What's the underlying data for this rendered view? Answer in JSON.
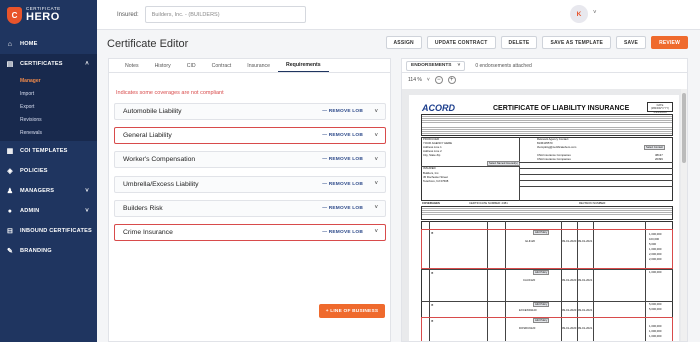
{
  "app": {
    "logo_small": "CERTIFICATE",
    "logo_big": "HERO",
    "logo_badge": "C"
  },
  "sidebar": {
    "items": [
      {
        "label": "HOME",
        "icon": "home-icon"
      },
      {
        "label": "CERTIFICATES",
        "icon": "document-icon"
      },
      {
        "label": "COI TEMPLATES",
        "icon": "template-icon"
      },
      {
        "label": "POLICIES",
        "icon": "shield-icon"
      },
      {
        "label": "MANAGERS",
        "icon": "users-icon"
      },
      {
        "label": "ADMIN",
        "icon": "user-icon"
      },
      {
        "label": "INBOUND CERTIFICATES",
        "icon": "inbox-icon"
      },
      {
        "label": "BRANDING",
        "icon": "brush-icon"
      }
    ],
    "sub_items": [
      "Manager",
      "Import",
      "Export",
      "Revisions",
      "Renewals"
    ]
  },
  "topbar": {
    "insured_label": "Insured:",
    "insured_value": "Builders, Inc. - (BUILDERS)",
    "avatar_initial": "K"
  },
  "header": {
    "title": "Certificate Editor",
    "actions": [
      "ASSIGN",
      "UPDATE CONTRACT",
      "DELETE",
      "SAVE AS TEMPLATE",
      "SAVE",
      "REVIEW"
    ]
  },
  "tabs": [
    "Notes",
    "History",
    "CID",
    "Contract",
    "Insurance",
    "Requirements"
  ],
  "active_tab": "Requirements",
  "warning": "Indicates some coverages are not compliant",
  "coverages": [
    {
      "name": "Automobile Liability",
      "remove": "— REMOVE LOB",
      "compliant": true
    },
    {
      "name": "General Liability",
      "remove": "— REMOVE LOB",
      "compliant": false
    },
    {
      "name": "Worker's Compensation",
      "remove": "— REMOVE LOB",
      "compliant": true
    },
    {
      "name": "Umbrella/Excess Liability",
      "remove": "— REMOVE LOB",
      "compliant": true
    },
    {
      "name": "Builders Risk",
      "remove": "— REMOVE LOB",
      "compliant": true
    },
    {
      "name": "Crime Insurance",
      "remove": "— REMOVE LOB",
      "compliant": false
    }
  ],
  "add_line": "+ LINE OF BUSINESS",
  "right_panel": {
    "endorsements_label": "ENDORSEMENTS",
    "endorsements_count": "0 endorsements attached",
    "zoom": "114 %"
  },
  "document": {
    "brand": "ACORD",
    "title": "CERTIFICATE OF LIABILITY INSURANCE",
    "date_label": "DATE (MM/DD/YYYY)",
    "date_value": "5/24/2023",
    "producer_label": "PRODUCER",
    "producer_lines": [
      "YOUR AGENCY HERE",
      "Address Line 1",
      "Address Line 2",
      "City, State Zip"
    ],
    "insured_label": "INSURED",
    "insured_lines": [
      "Builders, Inc.",
      "45 Rochester Street",
      "Teterboro, NJ 07608"
    ],
    "contact_name": "Relevant Agency Contact",
    "contact_phone": "8136105570",
    "contact_email": "thompking@certificatehero.com",
    "insurer_a": "CNA Insurance Companies",
    "insurer_b": "CNA Insurance Companies",
    "naic_a": "38137",
    "naic_b": "20399",
    "select_contact": "Select Contact",
    "select_insured": "Select Named Insured(s)",
    "coverages_label": "COVERAGES",
    "certificate_number_label": "CERTIFICATE NUMBER: 2381",
    "revision_label": "REVISION NUMBER:",
    "add_policy": "Add Policy",
    "policy_numbers": [
      "GLII120",
      "CAUII120",
      "EXCESS9120",
      "DOSRC9120"
    ],
    "eff_dates": [
      "09-01-2020",
      "09-01-2020",
      "09-01-2020",
      "09-01-2020"
    ],
    "exp_dates": [
      "09-01-2021",
      "09-01-2021",
      "09-01-2021",
      "09-01-2021"
    ],
    "limits": [
      "1,000,000",
      "100,000",
      "5,000",
      "1,000,000",
      "2,000,000",
      "2,000,000",
      "1,000,000",
      "5,000,000",
      "5,000,000",
      "1,000,000",
      "1,000,000",
      "1,000,000"
    ]
  }
}
